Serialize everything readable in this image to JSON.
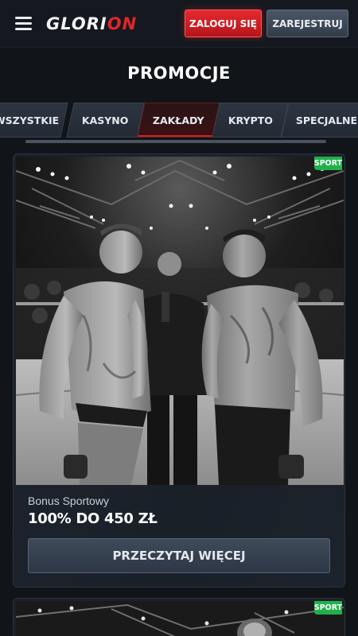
{
  "header": {
    "logo_white": "GLORI",
    "logo_red": "ON",
    "login_label": "ZALOGUJ SIĘ",
    "register_label": "ZAREJESTRUJ"
  },
  "page": {
    "title": "PROMOCJE"
  },
  "tabs": [
    {
      "label": "WSZYSTKIE",
      "active": false
    },
    {
      "label": "KASYNO",
      "active": false
    },
    {
      "label": "ZAKŁADY",
      "active": true
    },
    {
      "label": "KRYPTO",
      "active": false
    },
    {
      "label": "SPECJALNE",
      "active": false
    }
  ],
  "promotions": [
    {
      "badge": "SPORT",
      "subtitle": "Bonus Sportowy",
      "amount": "100% DO 450 ZŁ",
      "button_label": "PRZECZYTAJ WIĘCEJ",
      "image": "mma-fighters-faceoff-photo"
    },
    {
      "badge": "SPORT",
      "image": "arena-lights-photo"
    }
  ],
  "colors": {
    "accent_red": "#e42a2f",
    "sport_green": "#21b14c",
    "background": "#111418"
  }
}
